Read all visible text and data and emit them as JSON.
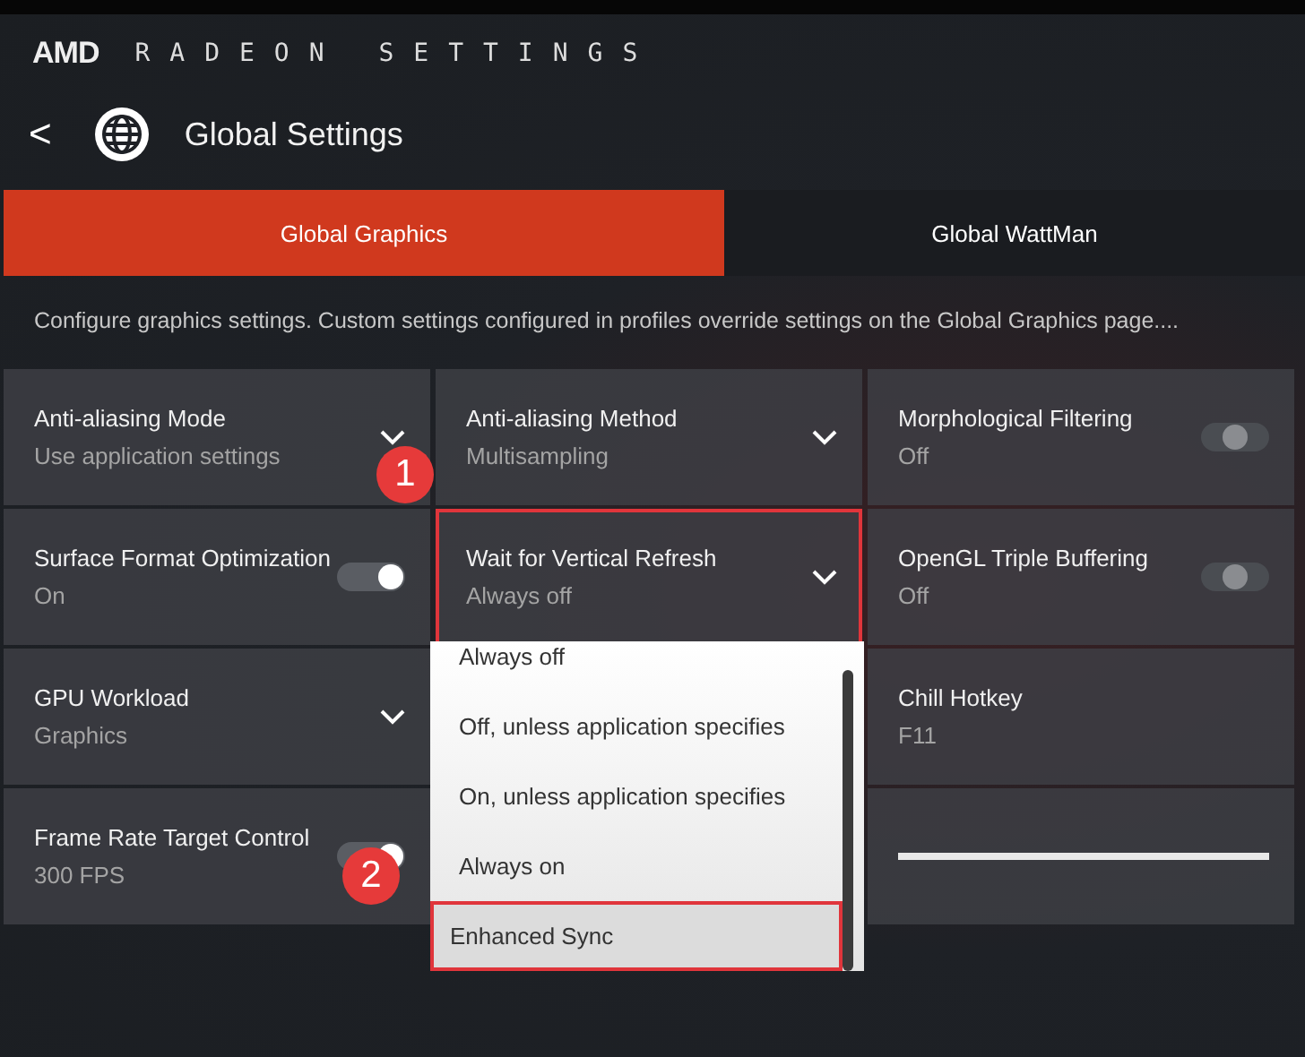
{
  "app": {
    "brand": "AMD",
    "title": "RADEON SETTINGS"
  },
  "page": {
    "back": "<",
    "title": "Global Settings"
  },
  "tabs": [
    {
      "label": "Global Graphics",
      "selected": true
    },
    {
      "label": "Global WattMan",
      "selected": false
    }
  ],
  "description": "Configure graphics settings. Custom settings configured in profiles override settings on the Global Graphics page....",
  "settings": [
    {
      "kind": "dropdown",
      "title": "Anti-aliasing Mode",
      "value": "Use application settings",
      "highlighted": false
    },
    {
      "kind": "dropdown",
      "title": "Anti-aliasing Method",
      "value": "Multisampling",
      "highlighted": false
    },
    {
      "kind": "toggle",
      "title": "Morphological Filtering",
      "value": "Off",
      "on": false,
      "highlighted": false
    },
    {
      "kind": "toggle",
      "title": "Surface Format Optimization",
      "value": "On",
      "on": true,
      "highlighted": false
    },
    {
      "kind": "dropdown",
      "title": "Wait for Vertical Refresh",
      "value": "Always off",
      "highlighted": true
    },
    {
      "kind": "toggle",
      "title": "OpenGL Triple Buffering",
      "value": "Off",
      "on": false,
      "highlighted": false
    },
    {
      "kind": "dropdown",
      "title": "GPU Workload",
      "value": "Graphics",
      "highlighted": false
    },
    {
      "kind": "hidden"
    },
    {
      "kind": "text",
      "title": "Chill Hotkey",
      "value": "F11",
      "highlighted": false
    },
    {
      "kind": "toggle",
      "title": "Frame Rate Target Control",
      "value": "300 FPS",
      "on": true,
      "highlighted": false
    },
    {
      "kind": "hidden"
    },
    {
      "kind": "slider"
    }
  ],
  "dropdown": {
    "options": [
      {
        "label": "Always off",
        "highlighted": false
      },
      {
        "label": "Off, unless application specifies",
        "highlighted": false
      },
      {
        "label": "On, unless application specifies",
        "highlighted": false
      },
      {
        "label": "Always on",
        "highlighted": false
      },
      {
        "label": "Enhanced Sync",
        "highlighted": true
      }
    ]
  },
  "markers": [
    {
      "label": "1"
    },
    {
      "label": "2"
    }
  ]
}
